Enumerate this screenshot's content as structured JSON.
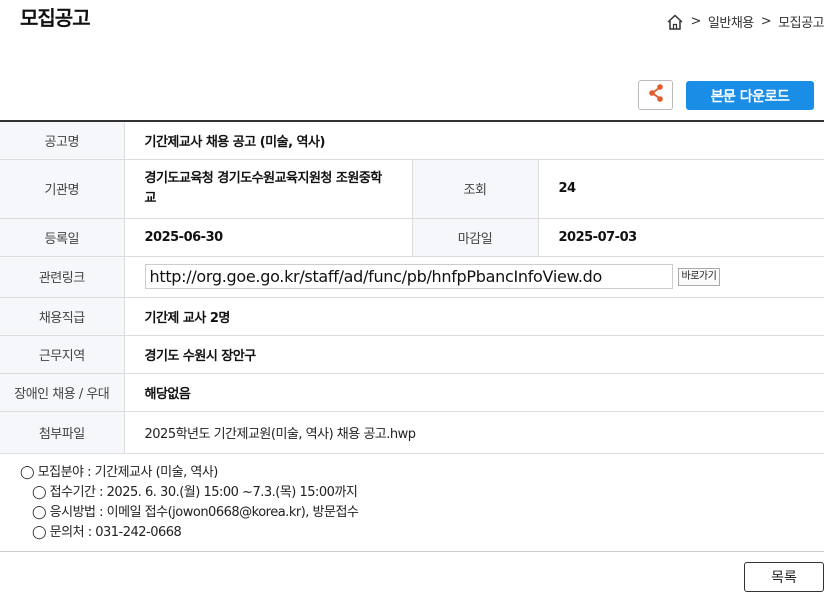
{
  "page": {
    "title": "모집공고"
  },
  "breadcrumb": {
    "home_icon": "home-icon",
    "sep1": ">",
    "item1": "일반채용",
    "sep2": ">",
    "item2": "모집공고"
  },
  "toolbar": {
    "share_icon": "share-icon",
    "download_label": "본문 다운로드"
  },
  "table": {
    "title_label": "공고명",
    "title_value": "기간제교사 채용 공고 (미술, 역사)",
    "org_label": "기관명",
    "org_value": "경기도교육청 경기도수원교육지원청 조원중학교",
    "views_label": "조회",
    "views_value": "24",
    "reg_label": "등록일",
    "reg_value": "2025-06-30",
    "deadline_label": "마감일",
    "deadline_value": "2025-07-03",
    "link_label": "관련링크",
    "link_value": "http://org.goe.go.kr/staff/ad/func/pb/hnfpPbancInfoView.do",
    "link_button": "바로가기",
    "position_label": "채용직급",
    "position_value": "기간제 교사 2명",
    "region_label": "근무지역",
    "region_value": "경기도 수원시 장안구",
    "disability_label": "장애인 채용 / 우대",
    "disability_value": "해당없음",
    "attach_label": "첨부파일",
    "attach_value": "2025학년도 기간제교원(미술, 역사) 채용 공고.hwp"
  },
  "notes": {
    "line1": "◯ 모집분야 : 기간제교사  (미술, 역사)",
    "line2": "◯ 접수기간 : 2025. 6. 30.(월) 15:00 ~7.3.(목) 15:00까지",
    "line3": "◯ 응시방법 : 이메일 접수(jowon0668@korea.kr), 방문접수",
    "line4": "◯ 문의처 : 031-242-0668"
  },
  "footer": {
    "list_button": "목록"
  },
  "colors": {
    "accent": "#1a8ee6",
    "header_bg": "#f5f7fa"
  }
}
